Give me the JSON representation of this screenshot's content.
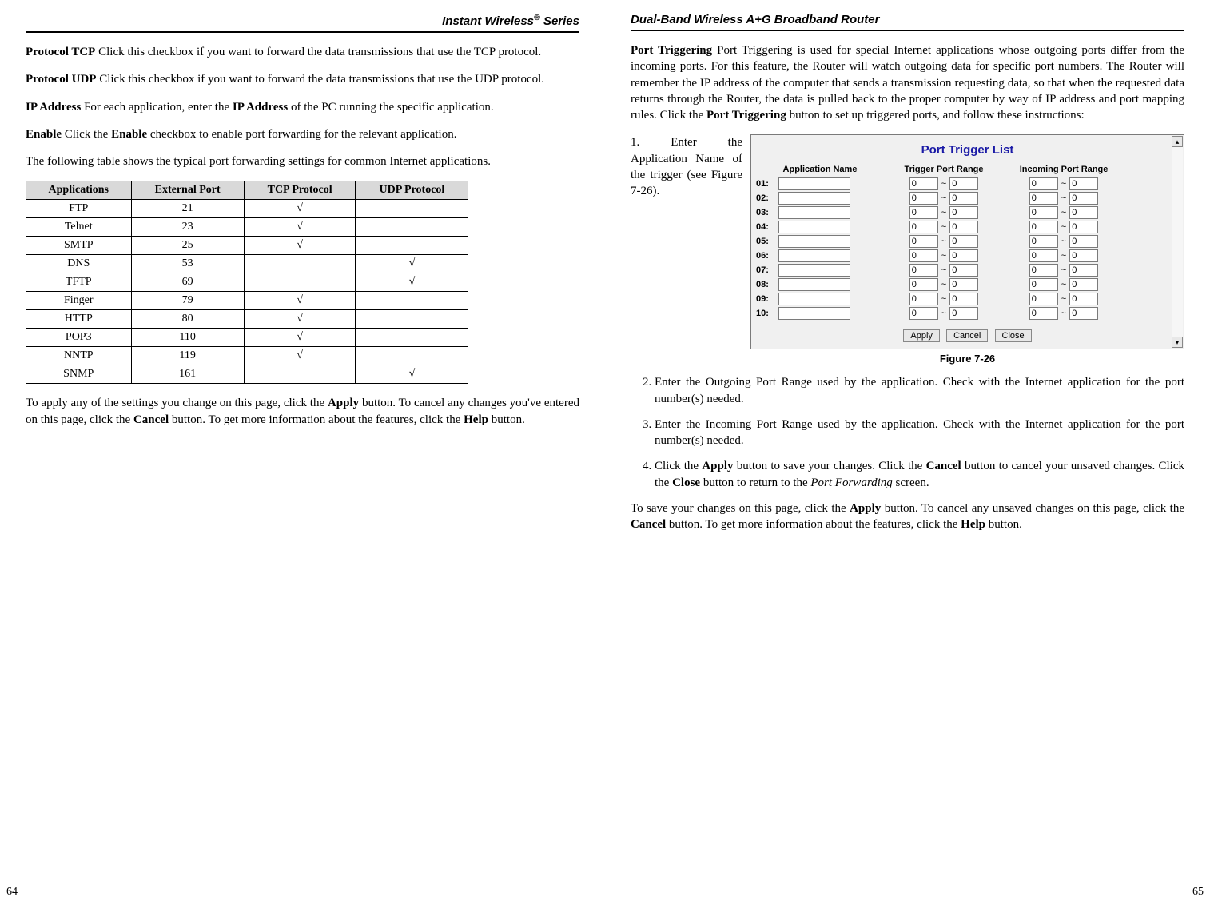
{
  "left": {
    "header_pre": "Instant Wireless",
    "header_post": " Series",
    "reg": "®",
    "p1a": "Protocol TCP",
    "p1b": "  Click this checkbox if you want to forward the data transmissions that use the TCP protocol.",
    "p2a": "Protocol UDP",
    "p2b": " Click this checkbox if you want to forward the data transmissions that use the UDP protocol.",
    "p3a": "IP Address",
    "p3b": "  For each application, enter the ",
    "p3c": "IP Address",
    "p3d": " of the PC running the specific application.",
    "p4a": "Enable",
    "p4b": "  Click the ",
    "p4c": "Enable",
    "p4d": " checkbox to enable port forwarding for the relevant application.",
    "p5": "The following table shows the typical port forwarding settings for common Internet applications.",
    "headers": [
      "Applications",
      "External Port",
      "TCP Protocol",
      "UDP Protocol"
    ],
    "rows": [
      {
        "app": "FTP",
        "port": "21",
        "tcp": "√",
        "udp": ""
      },
      {
        "app": "Telnet",
        "port": "23",
        "tcp": "√",
        "udp": ""
      },
      {
        "app": "SMTP",
        "port": "25",
        "tcp": "√",
        "udp": ""
      },
      {
        "app": "DNS",
        "port": "53",
        "tcp": "",
        "udp": "√"
      },
      {
        "app": "TFTP",
        "port": "69",
        "tcp": "",
        "udp": "√"
      },
      {
        "app": "Finger",
        "port": "79",
        "tcp": "√",
        "udp": ""
      },
      {
        "app": "HTTP",
        "port": "80",
        "tcp": "√",
        "udp": ""
      },
      {
        "app": "POP3",
        "port": "110",
        "tcp": "√",
        "udp": ""
      },
      {
        "app": "NNTP",
        "port": "119",
        "tcp": "√",
        "udp": ""
      },
      {
        "app": "SNMP",
        "port": "161",
        "tcp": "",
        "udp": "√"
      }
    ],
    "p6a": "To apply any of the settings you change on this page, click the ",
    "p6b": "Apply",
    "p6c": " button.  To cancel any changes you've entered on this page, click the ",
    "p6d": "Cancel",
    "p6e": " button. To get more information about the features, click the ",
    "p6f": "Help",
    "p6g": " button.",
    "page_num": "64"
  },
  "right": {
    "header": "Dual-Band Wireless A+G Broadband Router",
    "p1a": "Port Triggering",
    "p1b": "  Port Triggering is used for special Internet applications whose outgoing ports differ from the incoming ports. For this feature, the Router will watch outgoing data for specific port numbers. The Router will remember the IP address of the computer that sends a transmission requesting data, so that when the requested data returns through the Router, the data is pulled back to the proper computer by way of IP address and port mapping rules. Click the ",
    "p1c": "Port Triggering",
    "p1d": " button to set up triggered ports, and follow these instructions:",
    "step1_num": "1.",
    "step1": "Enter the Application Name of the trigger (see Figure 7-26).",
    "fig_title": "Port Trigger List",
    "col1": "Application Name",
    "col2": "Trigger Port Range",
    "col3": "Incoming Port Range",
    "rows": [
      "01:",
      "02:",
      "03:",
      "04:",
      "05:",
      "06:",
      "07:",
      "08:",
      "09:",
      "10:"
    ],
    "zero": "0",
    "tilde": "~",
    "btn_apply": "Apply",
    "btn_cancel": "Cancel",
    "btn_close": "Close",
    "fig_caption": "Figure 7-26",
    "step2": "Enter the Outgoing Port Range used by the application. Check with the Internet application for the port number(s) needed.",
    "step3": "Enter the Incoming Port Range used by the application. Check with the Internet application for the port number(s) needed.",
    "step4a": "Click the ",
    "step4b": "Apply",
    "step4c": " button to save your changes. Click the ",
    "step4d": "Cancel",
    "step4e": " button to cancel your unsaved changes. Click the ",
    "step4f": "Close",
    "step4g": " button to return to the ",
    "step4h": "Port Forwarding",
    "step4i": " screen.",
    "p2a": "To save your changes on this page, click the ",
    "p2b": "Apply",
    "p2c": " button. To cancel any unsaved changes on this page, click the ",
    "p2d": "Cancel",
    "p2e": " button. To get more information about the features, click the ",
    "p2f": "Help",
    "p2g": " button.",
    "page_num": "65"
  },
  "chart_data": {
    "type": "table",
    "title": "Typical port forwarding settings for common Internet applications",
    "columns": [
      "Applications",
      "External Port",
      "TCP Protocol",
      "UDP Protocol"
    ],
    "rows": [
      [
        "FTP",
        21,
        true,
        false
      ],
      [
        "Telnet",
        23,
        true,
        false
      ],
      [
        "SMTP",
        25,
        true,
        false
      ],
      [
        "DNS",
        53,
        false,
        true
      ],
      [
        "TFTP",
        69,
        false,
        true
      ],
      [
        "Finger",
        79,
        true,
        false
      ],
      [
        "HTTP",
        80,
        true,
        false
      ],
      [
        "POP3",
        110,
        true,
        false
      ],
      [
        "NNTP",
        119,
        true,
        false
      ],
      [
        "SNMP",
        161,
        false,
        true
      ]
    ]
  }
}
